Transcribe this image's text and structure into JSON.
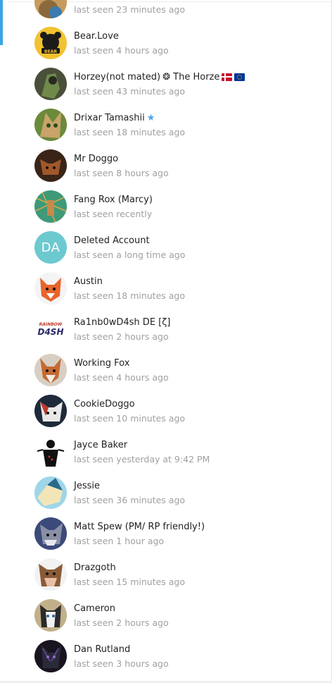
{
  "contacts": [
    {
      "name": "",
      "extra": "",
      "status": "last seen 23 minutes ago"
    },
    {
      "name": "Bear.Love",
      "extra": "",
      "status": "last seen 4 hours ago"
    },
    {
      "name": "Horzey(not mated)",
      "extra": "❂ The Horze",
      "status": "last seen 43 minutes ago"
    },
    {
      "name": "Drixar Tamashii",
      "extra": "★",
      "status": "last seen 18 minutes ago"
    },
    {
      "name": "Mr Doggo",
      "extra": "",
      "status": "last seen 8 hours ago"
    },
    {
      "name": "Fang Rox (Marcy)",
      "extra": "",
      "status": "last seen recently"
    },
    {
      "name": "Deleted Account",
      "extra": "",
      "status": "last seen a long time ago",
      "initials": "DA"
    },
    {
      "name": "Austin",
      "extra": "",
      "status": "last seen 18 minutes ago"
    },
    {
      "name": "Ra1nb0wD4sh DE [ζ]",
      "extra": "",
      "status": "last seen 2 hours ago"
    },
    {
      "name": "Working Fox",
      "extra": "",
      "status": "last seen 4 hours ago"
    },
    {
      "name": "CookieDoggo",
      "extra": "",
      "status": "last seen 10 minutes ago"
    },
    {
      "name": "Jayce Baker",
      "extra": "",
      "status": "last seen yesterday at 9:42 PM"
    },
    {
      "name": "Jessie",
      "extra": "",
      "status": "last seen 36 minutes ago"
    },
    {
      "name": "Matt Spew (PM/ RP friendly!)",
      "extra": "",
      "status": "last seen 1 hour ago"
    },
    {
      "name": "Drazgoth",
      "extra": "",
      "status": "last seen 15 minutes ago"
    },
    {
      "name": "Cameron",
      "extra": "",
      "status": "last seen 2 hours ago"
    },
    {
      "name": "Dan Rutland",
      "extra": "",
      "status": "last seen 3 hours ago"
    }
  ],
  "avatar_logo_rainbow": {
    "top": "RAINBOW",
    "bottom": "D4SH"
  },
  "avatar_logo_bear": "BEAR",
  "colors": {
    "accent": "#3ba3e6",
    "name_text": "#222222",
    "status_text": "#a0a0a0",
    "deleted_avatar": "#6cc9cf",
    "star": "#4aa6e8"
  }
}
